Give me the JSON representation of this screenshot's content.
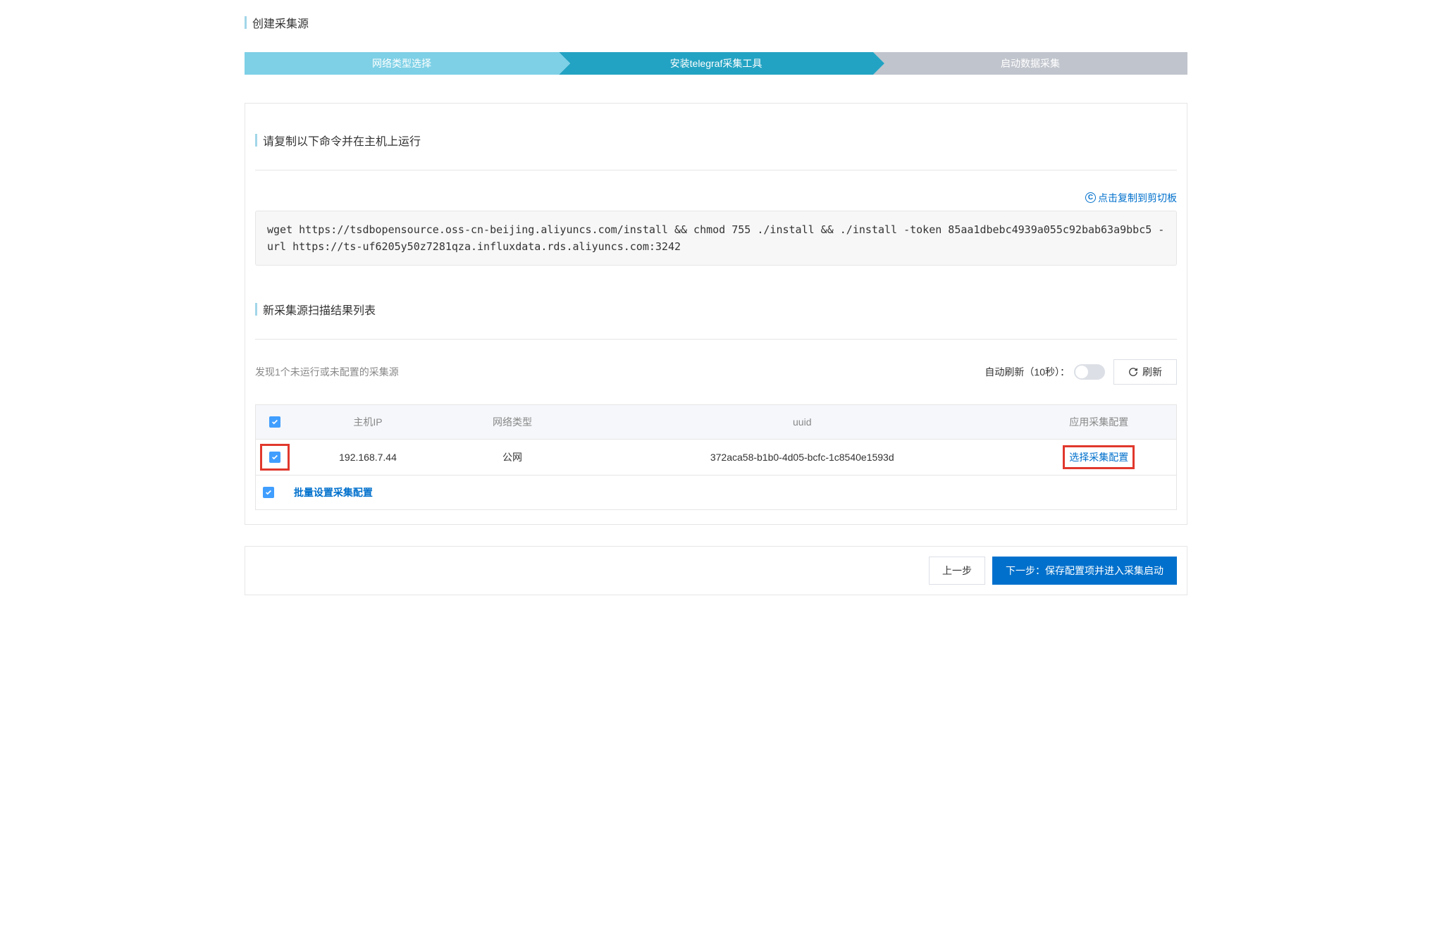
{
  "pageTitle": "创建采集源",
  "steps": {
    "s1": "网络类型选择",
    "s2": "安装telegraf采集工具",
    "s3": "启动数据采集"
  },
  "section1Title": "请复制以下命令并在主机上运行",
  "copyLink": "点击复制到剪切板",
  "command": "wget https://tsdbopensource.oss-cn-beijing.aliyuncs.com/install && chmod 755 ./install && ./install -token 85aa1dbebc4939a055c92bab63a9bbc5 -url https://ts-uf6205y50z7281qza.influxdata.rds.aliyuncs.com:3242",
  "section2Title": "新采集源扫描结果列表",
  "discoveredText": "发现1个未运行或未配置的采集源",
  "autoRefresh": "自动刷新（10秒）：",
  "refreshBtn": "刷新",
  "table": {
    "headers": {
      "hostIp": "主机IP",
      "netType": "网络类型",
      "uuid": "uuid",
      "appConfig": "应用采集配置"
    },
    "row": {
      "hostIp": "192.168.7.44",
      "netType": "公网",
      "uuid": "372aca58-b1b0-4d05-bcfc-1c8540e1593d",
      "action": "选择采集配置"
    },
    "batchAction": "批量设置采集配置"
  },
  "footer": {
    "prev": "上一步",
    "next": "下一步：保存配置项并进入采集启动"
  }
}
